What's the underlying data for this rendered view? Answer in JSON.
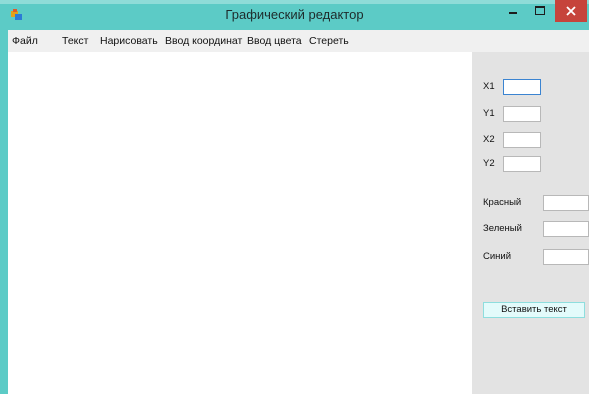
{
  "window": {
    "title": "Графический редактор"
  },
  "menu": [
    {
      "label": "Файл"
    },
    {
      "label": "Текст"
    },
    {
      "label": "Нарисовать"
    },
    {
      "label": "Ввод координат"
    },
    {
      "label": "Ввод цвета"
    },
    {
      "label": "Стереть"
    }
  ],
  "coords": {
    "x1": {
      "label": "X1",
      "value": ""
    },
    "y1": {
      "label": "Y1",
      "value": ""
    },
    "x2": {
      "label": "X2",
      "value": ""
    },
    "y2": {
      "label": "Y2",
      "value": ""
    }
  },
  "colors": {
    "red": {
      "label": "Красный",
      "value": ""
    },
    "green": {
      "label": "Зеленый",
      "value": ""
    },
    "blue": {
      "label": "Синий",
      "value": ""
    }
  },
  "insert_text_button": "Вставить текст",
  "theme": {
    "titlebar": "#5ccbc6",
    "close": "#c6443b",
    "panel": "#e3e3e3"
  }
}
